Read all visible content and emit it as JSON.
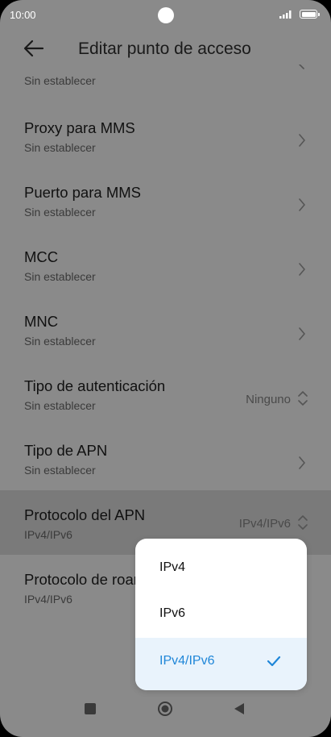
{
  "status_bar": {
    "time": "10:00"
  },
  "header": {
    "title": "Editar punto de acceso",
    "back_icon": "arrow-left-icon"
  },
  "list": {
    "partial_item": {
      "sub": "Sin establecer"
    },
    "items": [
      {
        "label": "Proxy para MMS",
        "sub": "Sin establecer"
      },
      {
        "label": "Puerto para MMS",
        "sub": "Sin establecer"
      },
      {
        "label": "MCC",
        "sub": "Sin establecer"
      },
      {
        "label": "MNC",
        "sub": "Sin establecer"
      },
      {
        "label": "Tipo de autenticación",
        "sub": "Sin establecer",
        "value": "Ninguno"
      },
      {
        "label": "Tipo de APN",
        "sub": "Sin establecer"
      },
      {
        "label": "Protocolo del APN",
        "sub": "IPv4/IPv6",
        "value": "IPv4/IPv6"
      },
      {
        "label": "Protocolo de roaming",
        "sub": "IPv4/IPv6"
      }
    ]
  },
  "popup": {
    "options": [
      "IPv4",
      "IPv6",
      "IPv4/IPv6"
    ],
    "selected": "IPv4/IPv6"
  },
  "colors": {
    "accent": "#1f86d8",
    "scrim": "#8a8a8a"
  }
}
